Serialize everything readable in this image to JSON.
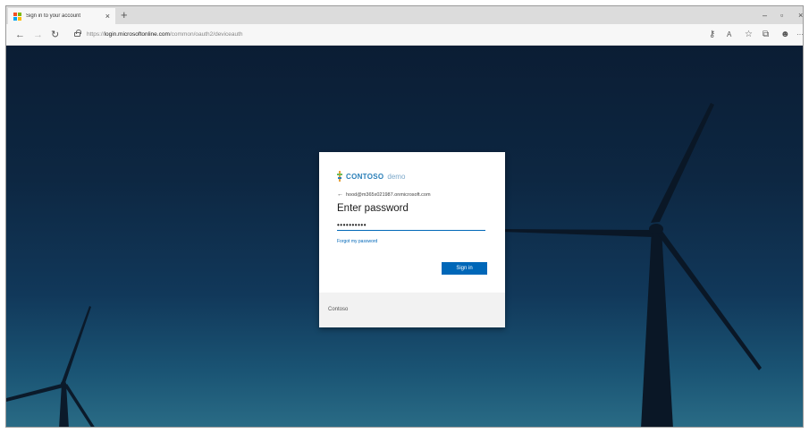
{
  "browser": {
    "tab_title": "Sign in to your account",
    "tab_close": "×",
    "new_tab": "+",
    "window_controls": {
      "minimize": "–",
      "restore": "▫",
      "close": "×"
    },
    "nav": {
      "back": "←",
      "forward": "→",
      "refresh": "↻"
    },
    "url": {
      "scheme": "https://",
      "host": "login.microsoftonline.com",
      "path": "/common/oauth2/deviceauth"
    },
    "toolbar_icons": [
      "key-icon",
      "read-aloud-icon",
      "favorite-star-icon",
      "collections-icon",
      "profile-icon",
      "more-icon"
    ],
    "toolbar_glyphs": {
      "key": "⚷",
      "read": "A",
      "star": "☆",
      "collections": "⧉",
      "profile": "☻",
      "more": "···"
    }
  },
  "signin": {
    "logo_text": "CONTOSO",
    "logo_sub": "demo",
    "back_glyph": "←",
    "identity": "hood@m365x021987.onmicrosoft.com",
    "heading": "Enter password",
    "password_value": "••••••••••",
    "forgot_label": "Forgot my password",
    "signin_label": "Sign in",
    "footer_text": "Contoso"
  },
  "colors": {
    "accent": "#0067b8",
    "brand": "#2a7fb8"
  }
}
